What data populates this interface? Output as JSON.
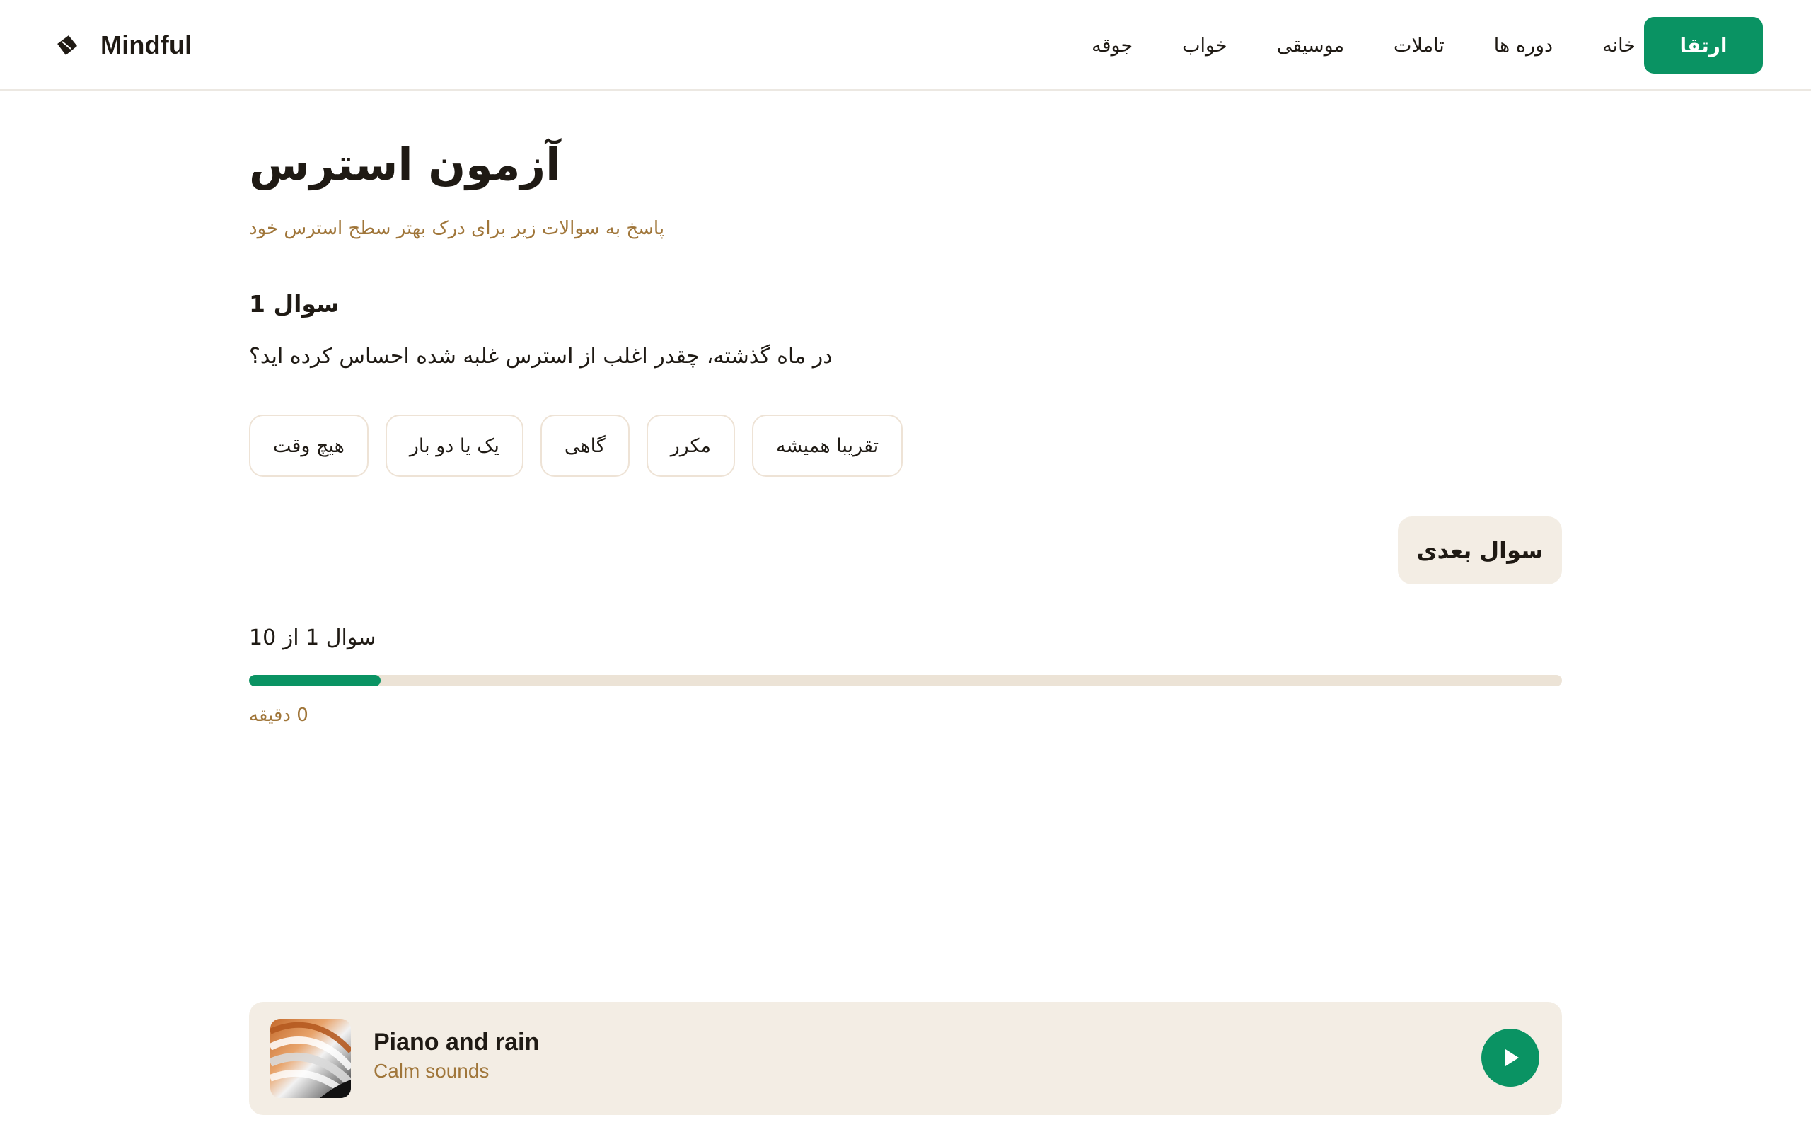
{
  "header": {
    "brand": "Mindful",
    "nav": [
      {
        "label": "خانه"
      },
      {
        "label": "دوره ها"
      },
      {
        "label": "تاملات"
      },
      {
        "label": "موسیقی"
      },
      {
        "label": "خواب"
      },
      {
        "label": "جوقه"
      }
    ],
    "upgrade_label": "ارتقا"
  },
  "quiz": {
    "title": "آزمون استرس",
    "subtitle": "پاسخ به سوالات زیر برای درک بهتر سطح استرس خود",
    "question_label": "سوال 1",
    "question_text": "در ماه گذشته، چقدر اغلب از استرس غلبه شده احساس کرده اید؟",
    "options": [
      {
        "label": "هیچ وقت"
      },
      {
        "label": "یک یا دو بار"
      },
      {
        "label": "گاهی"
      },
      {
        "label": "مکرر"
      },
      {
        "label": "تقریبا همیشه"
      }
    ],
    "next_label": "سوال بعدی",
    "progress_label": "سوال 1 از 10",
    "progress_fraction": 0.1,
    "timer": "0 دقیقه"
  },
  "player": {
    "title": "Piano and rain",
    "subtitle": "Calm sounds"
  },
  "colors": {
    "accent": "#0a9363",
    "muted_text": "#a0763a",
    "surface": "#f3ede4",
    "track": "#ece3d6"
  }
}
